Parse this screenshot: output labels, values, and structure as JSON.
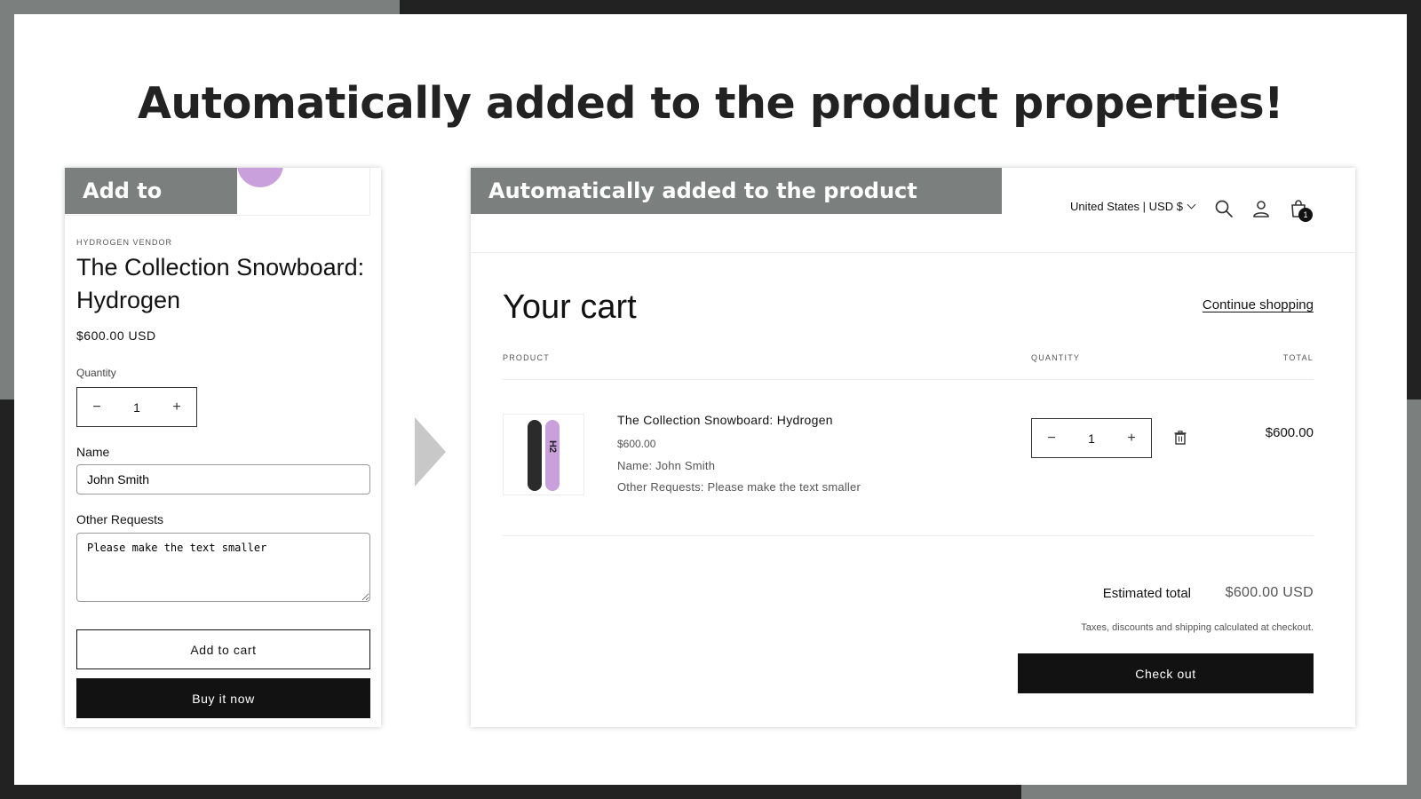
{
  "headline": "Automatically added to the product properties!",
  "product_panel": {
    "tag": "Add to cart...",
    "vendor": "HYDROGEN VENDOR",
    "title": "The Collection Snowboard: Hydrogen",
    "price": "$600.00 USD",
    "quantity_label": "Quantity",
    "quantity_value": "1",
    "minus": "−",
    "plus": "+",
    "name_label": "Name",
    "name_value": "John Smith",
    "requests_label": "Other Requests",
    "requests_value": "Please make the text smaller",
    "add_to_cart": "Add to cart",
    "buy_now": "Buy it now",
    "accent_color": "#c9a0dc"
  },
  "cart_panel": {
    "tag": "Automatically added to the product properties!",
    "country": "United States | USD $",
    "cart_count": "1",
    "title": "Your cart",
    "continue_shopping": "Continue shopping",
    "columns": {
      "product": "PRODUCT",
      "quantity": "QUANTITY",
      "total": "TOTAL"
    },
    "item": {
      "image_text": "H2",
      "title": "The Collection Snowboard: Hydrogen",
      "price": "$600.00",
      "prop_name": "Name: John Smith",
      "prop_requests": "Other Requests: Please make the text smaller",
      "quantity": "1",
      "minus": "−",
      "plus": "+",
      "line_total": "$600.00"
    },
    "estimated_label": "Estimated total",
    "estimated_value": "$600.00 USD",
    "taxes_note": "Taxes, discounts and shipping calculated at checkout.",
    "checkout": "Check out"
  },
  "icons": [
    "search-icon",
    "account-icon",
    "cart-icon",
    "trash-icon",
    "chevron-down-icon",
    "arrow-right-icon"
  ],
  "colors": {
    "tag_bg": "#7b7f7d",
    "frame": "#222222",
    "button_dark": "#121212"
  }
}
